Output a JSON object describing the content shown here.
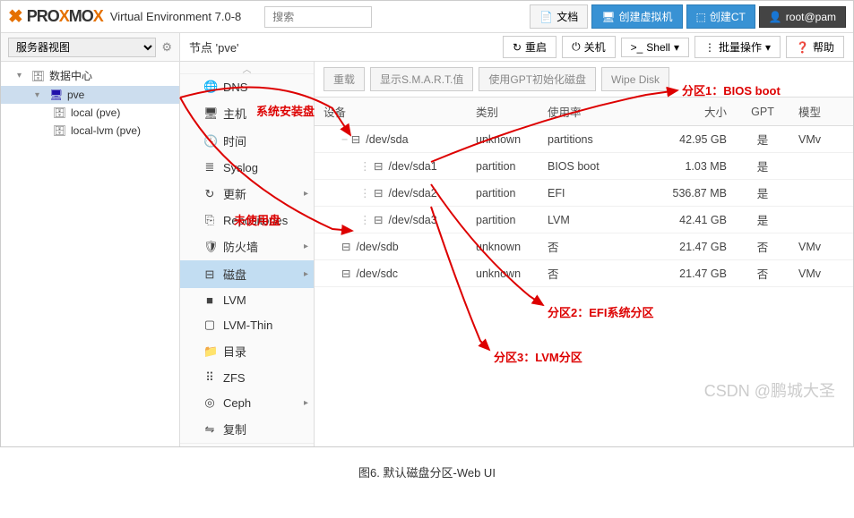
{
  "header": {
    "logo_brand": "PROXMOX",
    "ve_label": "Virtual Environment 7.0-8",
    "search_placeholder": "搜索",
    "docs_btn": "文档",
    "create_vm_btn": "创建虚拟机",
    "create_ct_btn": "创建CT",
    "user_label": "root@pam"
  },
  "view_selector": {
    "label": "服务器视图"
  },
  "node_toolbar": {
    "title": "节点 'pve'",
    "restart_btn": "重启",
    "shutdown_btn": "关机",
    "shell_btn": "Shell",
    "bulk_btn": "批量操作",
    "help_btn": "帮助"
  },
  "tree": {
    "datacenter": "数据中心",
    "node": "pve",
    "local": "local (pve)",
    "local_lvm": "local-lvm (pve)"
  },
  "sidenav": [
    {
      "icon": "🌐",
      "label": "DNS",
      "name": "dns"
    },
    {
      "icon": "🖥",
      "label": "主机",
      "name": "hosts"
    },
    {
      "icon": "🕓",
      "label": "时间",
      "name": "time"
    },
    {
      "icon": "≣",
      "label": "Syslog",
      "name": "syslog"
    },
    {
      "icon": "↻",
      "label": "更新",
      "name": "updates",
      "chev": true
    },
    {
      "icon": "⎘",
      "label": "Repositories",
      "name": "repositories"
    },
    {
      "icon": "🛡",
      "label": "防火墙",
      "name": "firewall",
      "chev": true
    },
    {
      "icon": "⊟",
      "label": "磁盘",
      "name": "disks",
      "active": true,
      "chev": true
    },
    {
      "icon": "■",
      "label": "LVM",
      "name": "lvm"
    },
    {
      "icon": "▢",
      "label": "LVM-Thin",
      "name": "lvm-thin"
    },
    {
      "icon": "📁",
      "label": "目录",
      "name": "directory"
    },
    {
      "icon": "⠿",
      "label": "ZFS",
      "name": "zfs"
    },
    {
      "icon": "◎",
      "label": "Ceph",
      "name": "ceph",
      "chev": true
    },
    {
      "icon": "⇋",
      "label": "复制",
      "name": "replication"
    }
  ],
  "content_toolbar": {
    "reload": "重载",
    "smart": "显示S.M.A.R.T.值",
    "gpt_init": "使用GPT初始化磁盘",
    "wipe": "Wipe Disk"
  },
  "columns": {
    "device": "设备",
    "type": "类别",
    "usage": "使用率",
    "size": "大小",
    "gpt": "GPT",
    "model": "模型"
  },
  "disks": [
    {
      "indent": 1,
      "expand": "−",
      "name": "/dev/sda",
      "type": "unknown",
      "usage": "partitions",
      "size": "42.95 GB",
      "gpt": "是",
      "model": "VMv"
    },
    {
      "indent": 2,
      "name": "/dev/sda1",
      "type": "partition",
      "usage": "BIOS boot",
      "size": "1.03 MB",
      "gpt": "是",
      "model": ""
    },
    {
      "indent": 2,
      "name": "/dev/sda2",
      "type": "partition",
      "usage": "EFI",
      "size": "536.87 MB",
      "gpt": "是",
      "model": ""
    },
    {
      "indent": 2,
      "name": "/dev/sda3",
      "type": "partition",
      "usage": "LVM",
      "size": "42.41 GB",
      "gpt": "是",
      "model": ""
    },
    {
      "indent": 1,
      "name": "/dev/sdb",
      "type": "unknown",
      "usage": "否",
      "size": "21.47 GB",
      "gpt": "否",
      "model": "VMv"
    },
    {
      "indent": 1,
      "name": "/dev/sdc",
      "type": "unknown",
      "usage": "否",
      "size": "21.47 GB",
      "gpt": "否",
      "model": "VMv"
    }
  ],
  "annotations": {
    "system_disk": "系统安装盘",
    "unused_disk": "未使用盘",
    "part1": "分区1：BIOS boot",
    "part2": "分区2：EFI系统分区",
    "part3": "分区3：LVM分区"
  },
  "watermark": "CSDN @鹏城大圣",
  "caption": "图6. 默认磁盘分区-Web UI"
}
